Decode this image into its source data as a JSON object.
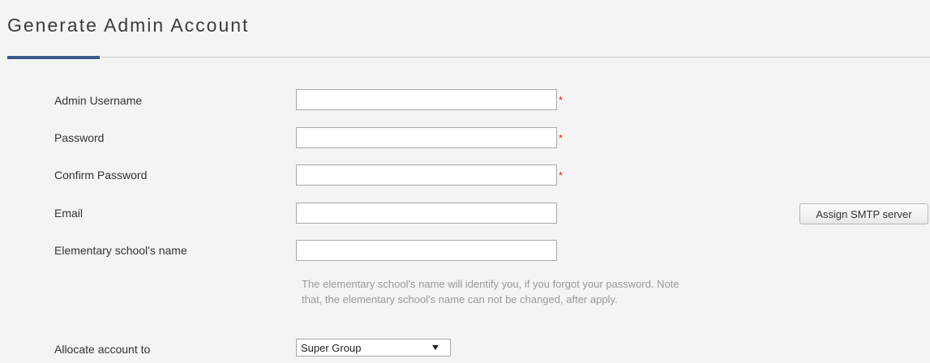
{
  "page": {
    "title": "Generate Admin Account"
  },
  "form": {
    "admin_username": {
      "label": "Admin Username",
      "value": "",
      "required_mark": "*"
    },
    "password": {
      "label": "Password",
      "value": "",
      "required_mark": "*"
    },
    "confirm_password": {
      "label": "Confirm Password",
      "value": "",
      "required_mark": "*"
    },
    "email": {
      "label": "Email",
      "value": ""
    },
    "school_name": {
      "label": "Elementary school's name",
      "value": "",
      "help_text": "The elementary school's name will identify you, if you forgot your password. Note that, the elementary school's name can not be changed, after apply."
    },
    "allocate": {
      "label": "Allocate account to",
      "selected": "Super Group"
    }
  },
  "buttons": {
    "assign_smtp": "Assign SMTP server"
  },
  "icons": {
    "select_arrow": "caret-down-icon"
  },
  "colors": {
    "accent": "#3c5a8c",
    "required": "#e02020",
    "help_text": "#999999"
  }
}
